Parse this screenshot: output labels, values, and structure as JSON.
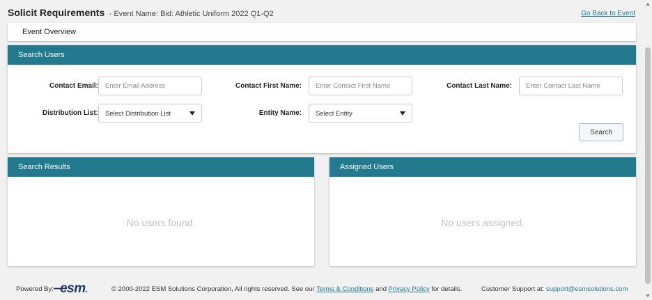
{
  "header": {
    "title": "Solicit Requirements",
    "event_name": "- Event Name: Bid: Athletic Uniform 2022 Q1-Q2",
    "back_link": "Go Back to Event"
  },
  "overview": {
    "tab_label": "Event Overview"
  },
  "search_panel": {
    "title": "Search Users",
    "contact_email_label": "Contact Email:",
    "contact_email_placeholder": "Enter Email Address",
    "contact_first_label": "Contact First Name:",
    "contact_first_placeholder": "Enter Contact First Name",
    "contact_last_label": "Contact Last Name:",
    "contact_last_placeholder": "Enter Contact Last Name",
    "distribution_label": "Distribution List:",
    "distribution_value": "Select Distribution List",
    "entity_label": "Entity Name:",
    "entity_value": "Select Entity",
    "search_button": "Search"
  },
  "results_panel": {
    "title": "Search Results",
    "empty_message": "No users found."
  },
  "assigned_panel": {
    "title": "Assigned Users",
    "empty_message": "No users assigned."
  },
  "footer": {
    "powered_by": "Powered By:",
    "logo_text": "esm",
    "copyright_prefix": "© 2000-2022 ESM Solutions Corporation, All rights reserved. See our",
    "terms_link": "Terms & Conditions",
    "and_text": "and",
    "privacy_link": "Privacy Policy",
    "details_text": "for details.",
    "support_label": "Customer Support at:",
    "support_email": "support@esmsolutions.com"
  },
  "colors": {
    "accent": "#237a8f",
    "link": "#1e7b8c",
    "logo": "#223a66"
  },
  "icons": {
    "dropdown": "caret-down-icon"
  }
}
